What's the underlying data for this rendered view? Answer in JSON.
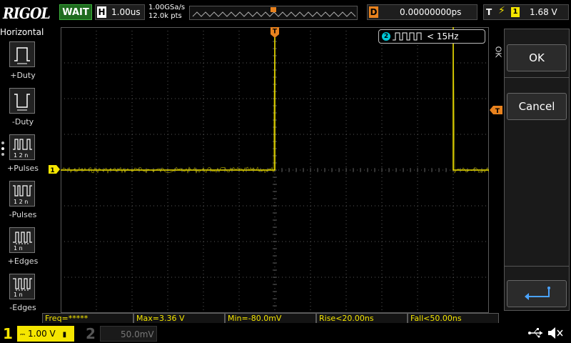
{
  "header": {
    "brand": "RIGOL",
    "run_state": "WAIT",
    "timebase_label": "H",
    "timebase_value": "1.00us",
    "sample_rate": "1.00GSa/s",
    "memory_depth": "12.0k pts",
    "delay_label": "D",
    "delay_value": "0.00000000ps",
    "trigger_label": "T",
    "trigger_source": "1",
    "trigger_level": "1.68 V"
  },
  "left_menu": {
    "title": "Horizontal",
    "items": [
      {
        "label": "+Duty",
        "icon": "positive-duty-icon"
      },
      {
        "label": "-Duty",
        "icon": "negative-duty-icon"
      },
      {
        "label": "+Pulses",
        "icon": "positive-pulses-icon",
        "sub": "1 2  n"
      },
      {
        "label": "-Pulses",
        "icon": "negative-pulses-icon",
        "sub": "1 2  n"
      },
      {
        "label": "+Edges",
        "icon": "positive-edges-icon",
        "sub": "1    n"
      },
      {
        "label": "-Edges",
        "icon": "negative-edges-icon",
        "sub": "1    n"
      }
    ]
  },
  "right_menu": {
    "side_label": "OK",
    "ok_label": "OK",
    "cancel_label": "Cancel"
  },
  "freq_counter": {
    "channel": "2",
    "value": "< 15Hz"
  },
  "markers": {
    "ch1_marker": "1",
    "trigger_pos": "T",
    "trigger_level": "T"
  },
  "measurements": [
    {
      "label": "Freq=*****"
    },
    {
      "label": "Max=3.36 V"
    },
    {
      "label": "Min=-80.0mV"
    },
    {
      "label": "Rise<20.00ns"
    },
    {
      "label": "Fall<50.00ns"
    }
  ],
  "channels": {
    "ch1_num": "1",
    "ch1_scale": "1.00 V",
    "ch2_num": "2",
    "ch2_scale": "50.0mV"
  },
  "colors": {
    "ch1": "#f5e600",
    "ch2": "#00c8d8",
    "trigger": "#e8821e",
    "grid": "#5a5a5a"
  },
  "waveform": {
    "low_level_div": 0.0,
    "high_level_div": 4.2,
    "rise_time_div": 0.0,
    "fall_time_div": 5.0
  }
}
